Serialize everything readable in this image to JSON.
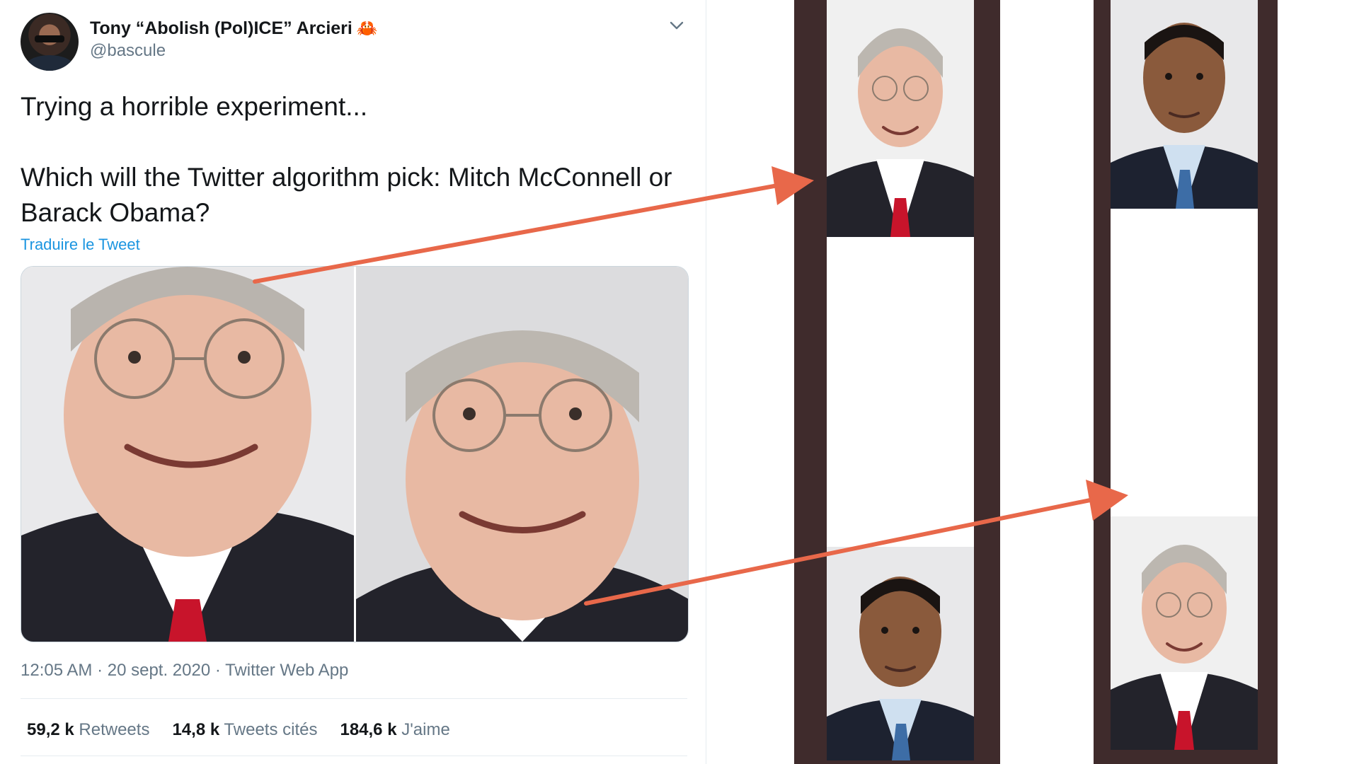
{
  "tweet": {
    "display_name": "Tony “Abolish (Pol)ICE” Arcieri",
    "crab_emoji": "🦀",
    "handle": "@bascule",
    "text_line1": "Trying a horrible experiment...",
    "text_line2": "Which will the Twitter algorithm pick: Mitch McConnell or",
    "text_line3": "Barack Obama?",
    "translate_link": "Traduire le Tweet",
    "meta": "12:05 AM · 20 sept. 2020 · Twitter Web App",
    "stats": {
      "retweets_count": "59,2 k",
      "retweets_label": "Retweets",
      "quotes_count": "14,8 k",
      "quotes_label": "Tweets cités",
      "likes_count": "184,6 k",
      "likes_label": "J'aime"
    }
  },
  "icons": [
    "chevron-down-icon",
    "crab-emoji-icon",
    "avatar"
  ],
  "colors": {
    "arrow": "#e8684a",
    "link": "#1b95e0",
    "strip_border": "#3f2b2c",
    "muted_text": "#657786"
  }
}
